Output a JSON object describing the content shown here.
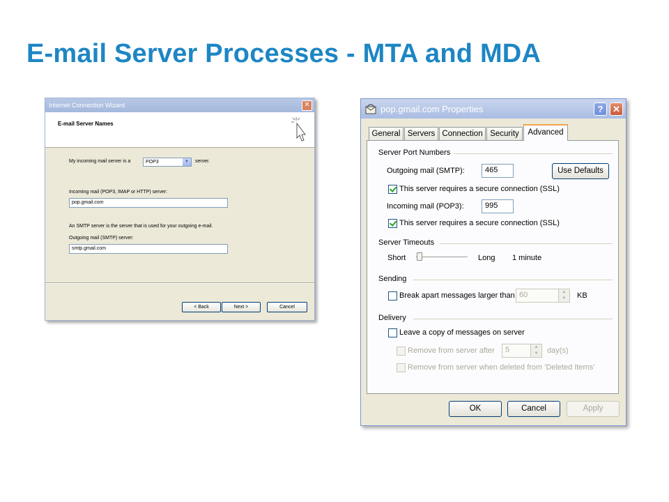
{
  "slide": {
    "title": "E-mail Server Processes - MTA and MDA"
  },
  "wizard": {
    "window_title": "Internet Connection Wizard",
    "close_glyph": "✕",
    "header_title": "E-mail Server Names",
    "incoming_type_prefix": "My incoming mail server is a",
    "incoming_type_value": "POP3",
    "incoming_type_suffix": "server.",
    "incoming_label": "Incoming mail (POP3, IMAP or HTTP) server:",
    "incoming_value": "pop.gmail.com",
    "smtp_note": "An SMTP server is the server that is used for your outgoing e-mail.",
    "outgoing_label": "Outgoing mail (SMTP) server:",
    "outgoing_value": "smtp.gmail.com",
    "buttons": {
      "back": "< Back",
      "next": "Next >",
      "cancel": "Cancel"
    }
  },
  "properties": {
    "window_title": "pop.gmail.com Properties",
    "help_glyph": "?",
    "close_glyph": "✕",
    "tabs": [
      "General",
      "Servers",
      "Connection",
      "Security",
      "Advanced"
    ],
    "active_tab": "Advanced",
    "server_port_numbers": {
      "heading": "Server Port Numbers",
      "outgoing_label": "Outgoing mail (SMTP):",
      "outgoing_value": "465",
      "use_defaults": "Use Defaults",
      "outgoing_ssl_label": "This server requires a secure connection (SSL)",
      "outgoing_ssl_checked": true,
      "incoming_label": "Incoming mail (POP3):",
      "incoming_value": "995",
      "incoming_ssl_label": "This server requires a secure connection (SSL)",
      "incoming_ssl_checked": true
    },
    "server_timeouts": {
      "heading": "Server Timeouts",
      "short_label": "Short",
      "long_label": "Long",
      "value_text": "1 minute"
    },
    "sending": {
      "heading": "Sending",
      "break_label": "Break apart messages larger than",
      "break_checked": false,
      "break_value": "60",
      "unit": "KB"
    },
    "delivery": {
      "heading": "Delivery",
      "leave_copy_label": "Leave a copy of messages on server",
      "leave_copy_checked": false,
      "remove_after_label": "Remove from server after",
      "remove_after_value": "5",
      "remove_after_unit": "day(s)",
      "remove_deleted_label": "Remove from server when deleted from 'Deleted Items'"
    },
    "buttons": {
      "ok": "OK",
      "cancel": "Cancel",
      "apply": "Apply"
    }
  }
}
